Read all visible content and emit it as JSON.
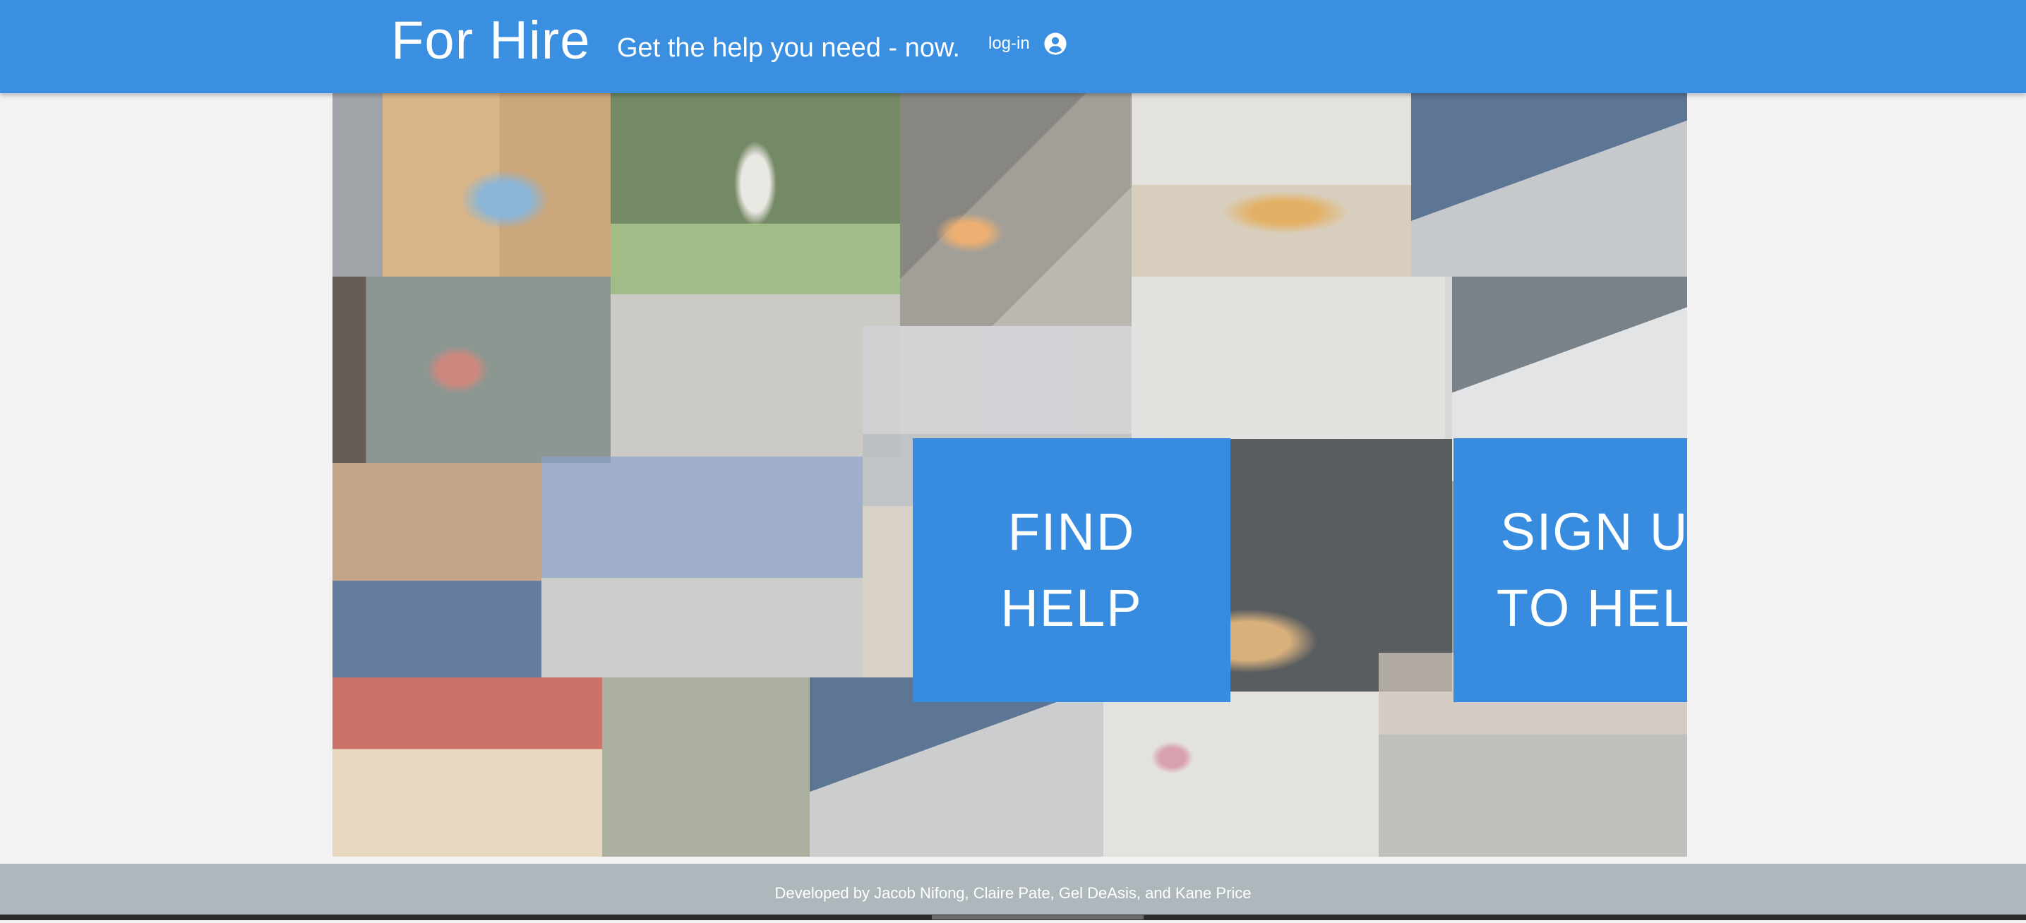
{
  "header": {
    "title": "For Hire",
    "tagline": "Get the help you need - now.",
    "login_label": "log-in",
    "account_icon": "account-circle-icon"
  },
  "actions": {
    "find_help_line1": "FIND",
    "find_help_line2": "HELP",
    "sign_up_line1": "SIGN UP",
    "sign_up_line2": "TO HELP"
  },
  "collage": {
    "photos": [
      "paint-brush-on-wood",
      "girl-on-swing",
      "metal-grinder-sparks",
      "plated-desserts",
      "laptop-code",
      "we-are-open-sign",
      "pens-on-paper",
      "office-lobby",
      "mechanic-engine",
      "warehouse-cleaner",
      "suburban-house",
      "tutor-with-child",
      "worker-red-cap",
      "pizza",
      "girl-with-laptop",
      "cash-briefcase",
      "laptop-code-2",
      "table-setting",
      "newspapers"
    ]
  },
  "footer": {
    "credits": "Developed by Jacob Nifong, Claire Pate, Gel DeAsis, and Kane Price"
  },
  "colors": {
    "primary": "#3a8fe0",
    "footer": "#aeb7bc",
    "background": "#f2f2f2"
  }
}
